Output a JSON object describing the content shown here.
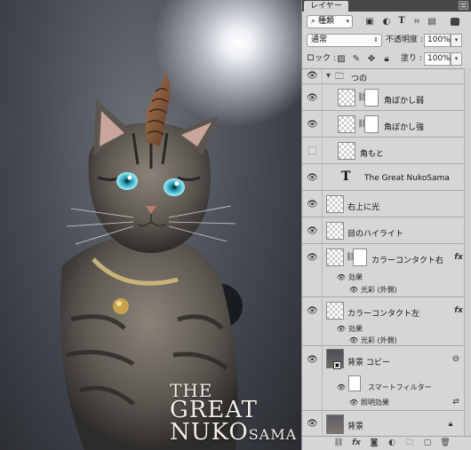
{
  "photo": {
    "title_line1": "THE",
    "title_line2": "GREAT",
    "title_line3_main": "NUKO",
    "title_line3_small": "SAMA"
  },
  "panel": {
    "tab_label": "レイヤー",
    "filter": {
      "kind_label": "種類"
    },
    "blend": {
      "mode": "通常",
      "opacity_label": "不透明度 :",
      "opacity_value": "100%"
    },
    "lock": {
      "label": "ロック :",
      "fill_label": "塗り :",
      "fill_value": "100%"
    },
    "layers": [
      {
        "name": "つの",
        "type": "group"
      },
      {
        "name": "角ぼかし弱",
        "type": "pixel-mask"
      },
      {
        "name": "角ぼかし強",
        "type": "pixel-mask"
      },
      {
        "name": "角もと",
        "type": "pixel",
        "hidden": true
      },
      {
        "name": "The Great NukoSama",
        "type": "text"
      },
      {
        "name": "右上に光",
        "type": "pixel"
      },
      {
        "name": "目のハイライト",
        "type": "pixel"
      },
      {
        "name": "カラーコンタクト右",
        "type": "pixel-mask-fx"
      },
      {
        "name": "カラーコンタクト左",
        "type": "pixel-fx"
      },
      {
        "name": "背景 コピー",
        "type": "smart"
      },
      {
        "name": "背景",
        "type": "background"
      }
    ],
    "effects_label": "効果",
    "outer_glow_label": "光彩 (外側)",
    "smart_filter_label": "スマートフィルター",
    "lighting_effect_label": "照明効果",
    "fx_glyph": "fx",
    "text_layer_glyph": "T"
  }
}
